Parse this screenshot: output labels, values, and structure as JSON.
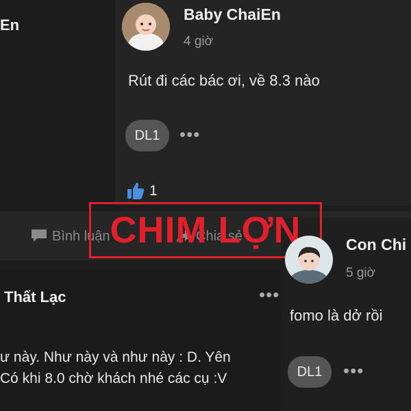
{
  "left_post": {
    "name_fragment": "En",
    "action_comment": "Bình luận",
    "action_share": "Chia sẻ"
  },
  "post_baby": {
    "author": "Baby ChaiEn",
    "time": "4 giờ",
    "message": "Rút đi các bác ơi, về 8.3 nào",
    "chip": "DL1",
    "like_count": "1"
  },
  "post_con": {
    "author": "Con Chi",
    "time": "5 giờ",
    "message": "fomo là dở rồi",
    "chip": "DL1"
  },
  "post_lost": {
    "author": "Thất Lạc",
    "line1": "ư này. Như này và như này : D. Yên",
    "line2": "Có khi 8.0 chờ khách nhé các cụ  :V"
  },
  "watermark": {
    "text": "CHIM LỢN",
    "color": "#e0202a"
  },
  "colors": {
    "like_blue": "#4a8fe0",
    "background": "#1e1e1e"
  }
}
